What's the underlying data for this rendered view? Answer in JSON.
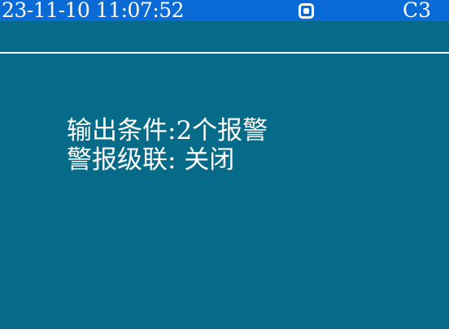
{
  "status_bar": {
    "datetime": "23-11-10 11:07:52",
    "center_icon": "record-icon",
    "channel_code": "C3"
  },
  "content": {
    "output_condition": "输出条件:2个报警",
    "alarm_cascade": "警报级联: 关闭"
  },
  "colors": {
    "background": "#066b88",
    "status_bar": "#0a6bd6",
    "text": "#ffffff"
  }
}
